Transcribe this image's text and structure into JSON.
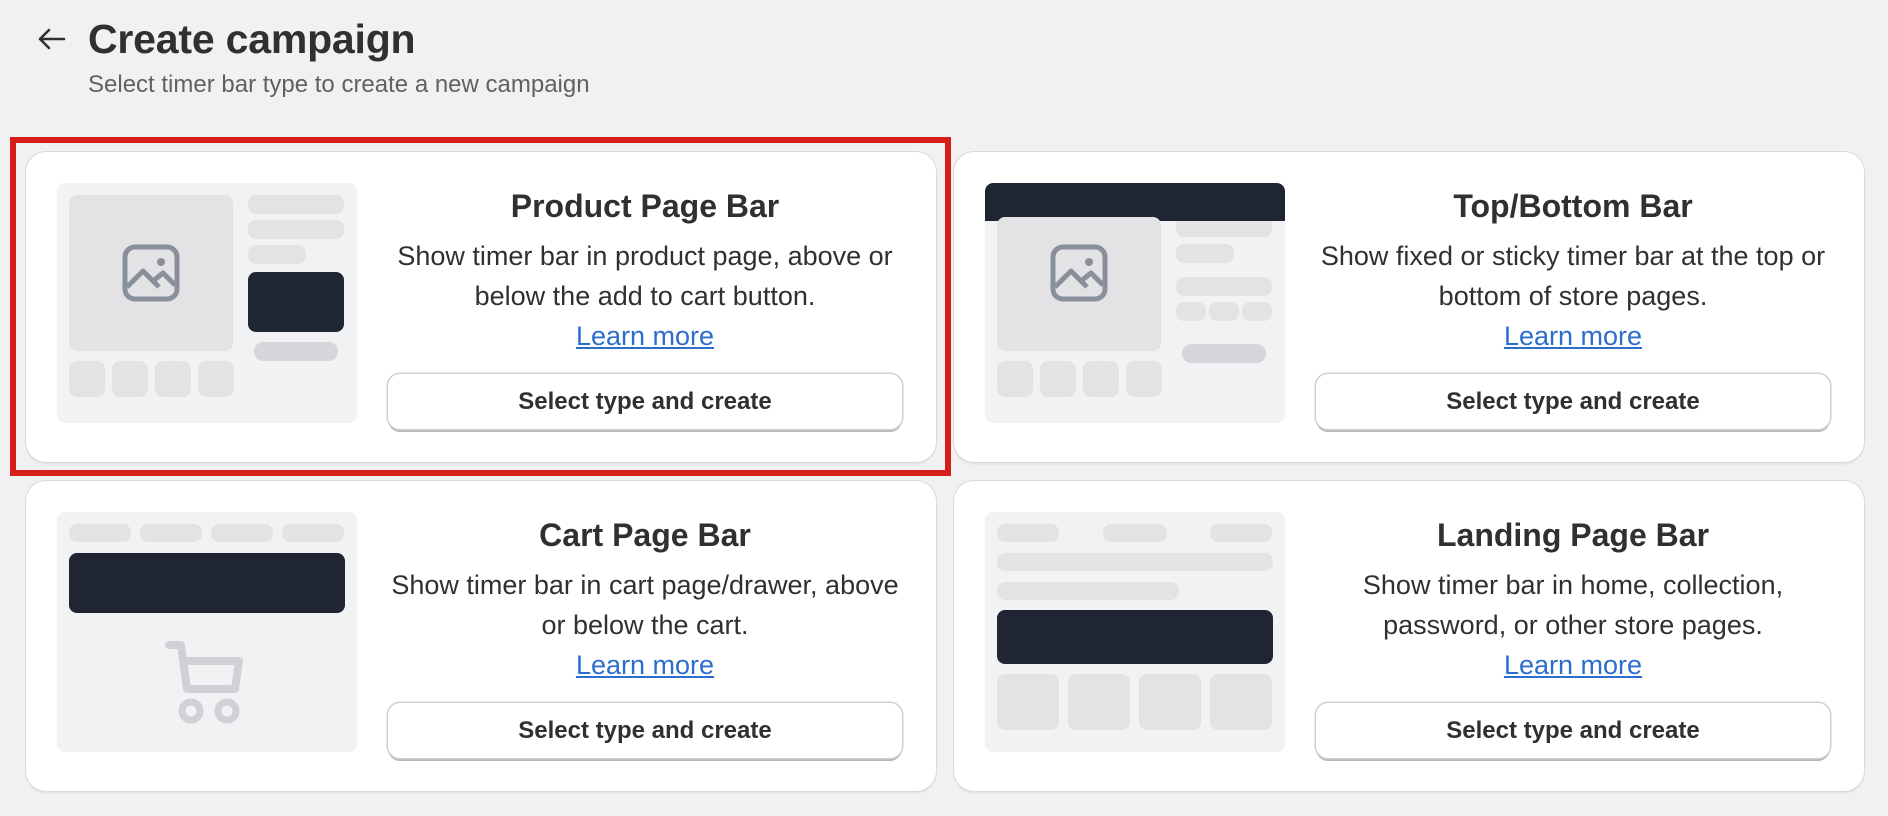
{
  "header": {
    "title": "Create campaign",
    "subtitle": "Select timer bar type to create a new campaign"
  },
  "cards": [
    {
      "title": "Product Page Bar",
      "description": "Show timer bar in product page, above or below the add to cart button.",
      "learn_more": "Learn more",
      "button": "Select type and create",
      "thumbnail_icon": "image-icon",
      "selected": true
    },
    {
      "title": "Top/Bottom Bar",
      "description": "Show fixed or sticky timer bar at the top or bottom of store pages.",
      "learn_more": "Learn more",
      "button": "Select type and create",
      "thumbnail_icon": "image-icon",
      "selected": false
    },
    {
      "title": "Cart Page Bar",
      "description": "Show timer bar in cart page/drawer, above or below the cart.",
      "learn_more": "Learn more",
      "button": "Select type and create",
      "thumbnail_icon": "cart-icon",
      "selected": false
    },
    {
      "title": "Landing Page Bar",
      "description": "Show timer bar in home, collection, password, or other store pages.",
      "learn_more": "Learn more",
      "button": "Select type and create",
      "thumbnail_icon": "none",
      "selected": false
    }
  ],
  "colors": {
    "background": "#f1f1f1",
    "highlight": "#d61f1a",
    "link": "#2c6ecb",
    "placeholder_dark": "#1f2532"
  }
}
